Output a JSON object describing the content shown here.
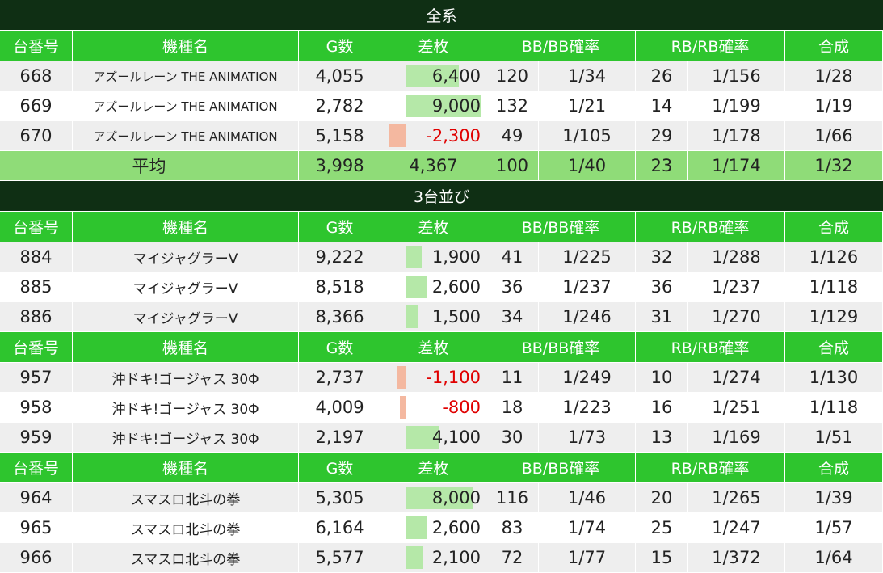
{
  "headers": [
    "台番号",
    "機種名",
    "G数",
    "差枚",
    "BB/BB確率",
    "RB/RB確率",
    "合成"
  ],
  "colors": {
    "section_bg": "#0f2f14",
    "header_bg": "#2ec52e",
    "avg_bg": "#8fdc78",
    "bar_positive": "#b5e8a8",
    "bar_negative": "#f4b8a0",
    "negative_text": "#e00000"
  },
  "sections": [
    {
      "title": "全系",
      "groups": [
        {
          "rows": [
            {
              "no": "668",
              "name": "アズールレーン THE ANIMATION",
              "games": "4,055",
              "diff": "6,400",
              "diff_value": 6400,
              "bb": "120",
              "bb_rate": "1/34",
              "rb": "26",
              "rb_rate": "1/156",
              "total": "1/28"
            },
            {
              "no": "669",
              "name": "アズールレーン THE ANIMATION",
              "games": "2,782",
              "diff": "9,000",
              "diff_value": 9000,
              "bb": "132",
              "bb_rate": "1/21",
              "rb": "14",
              "rb_rate": "1/199",
              "total": "1/19"
            },
            {
              "no": "670",
              "name": "アズールレーン THE ANIMATION",
              "games": "5,158",
              "diff": "-2,300",
              "diff_value": -2300,
              "bb": "49",
              "bb_rate": "1/105",
              "rb": "29",
              "rb_rate": "1/178",
              "total": "1/66"
            }
          ]
        }
      ],
      "average": {
        "label": "平均",
        "games": "3,998",
        "diff": "4,367",
        "bb": "100",
        "bb_rate": "1/40",
        "rb": "23",
        "rb_rate": "1/174",
        "total": "1/32"
      }
    },
    {
      "title": "3台並び",
      "groups": [
        {
          "rows": [
            {
              "no": "884",
              "name": "マイジャグラーV",
              "games": "9,222",
              "diff": "1,900",
              "diff_value": 1900,
              "bb": "41",
              "bb_rate": "1/225",
              "rb": "32",
              "rb_rate": "1/288",
              "total": "1/126"
            },
            {
              "no": "885",
              "name": "マイジャグラーV",
              "games": "8,518",
              "diff": "2,600",
              "diff_value": 2600,
              "bb": "36",
              "bb_rate": "1/237",
              "rb": "36",
              "rb_rate": "1/237",
              "total": "1/118"
            },
            {
              "no": "886",
              "name": "マイジャグラーV",
              "games": "8,366",
              "diff": "1,500",
              "diff_value": 1500,
              "bb": "34",
              "bb_rate": "1/246",
              "rb": "31",
              "rb_rate": "1/270",
              "total": "1/129"
            }
          ]
        },
        {
          "rows": [
            {
              "no": "957",
              "name": "沖ドキ!ゴージャス 30Φ",
              "games": "2,737",
              "diff": "-1,100",
              "diff_value": -1100,
              "bb": "11",
              "bb_rate": "1/249",
              "rb": "10",
              "rb_rate": "1/274",
              "total": "1/130"
            },
            {
              "no": "958",
              "name": "沖ドキ!ゴージャス 30Φ",
              "games": "4,009",
              "diff": "-800",
              "diff_value": -800,
              "bb": "18",
              "bb_rate": "1/223",
              "rb": "16",
              "rb_rate": "1/251",
              "total": "1/118"
            },
            {
              "no": "959",
              "name": "沖ドキ!ゴージャス 30Φ",
              "games": "2,197",
              "diff": "4,100",
              "diff_value": 4100,
              "bb": "30",
              "bb_rate": "1/73",
              "rb": "13",
              "rb_rate": "1/169",
              "total": "1/51"
            }
          ]
        },
        {
          "rows": [
            {
              "no": "964",
              "name": "スマスロ北斗の拳",
              "games": "5,305",
              "diff": "8,000",
              "diff_value": 8000,
              "bb": "116",
              "bb_rate": "1/46",
              "rb": "20",
              "rb_rate": "1/265",
              "total": "1/39"
            },
            {
              "no": "965",
              "name": "スマスロ北斗の拳",
              "games": "6,164",
              "diff": "2,600",
              "diff_value": 2600,
              "bb": "83",
              "bb_rate": "1/74",
              "rb": "25",
              "rb_rate": "1/247",
              "total": "1/57"
            },
            {
              "no": "966",
              "name": "スマスロ北斗の拳",
              "games": "5,577",
              "diff": "2,100",
              "diff_value": 2100,
              "bb": "72",
              "bb_rate": "1/77",
              "rb": "15",
              "rb_rate": "1/372",
              "total": "1/64"
            }
          ]
        }
      ]
    }
  ]
}
